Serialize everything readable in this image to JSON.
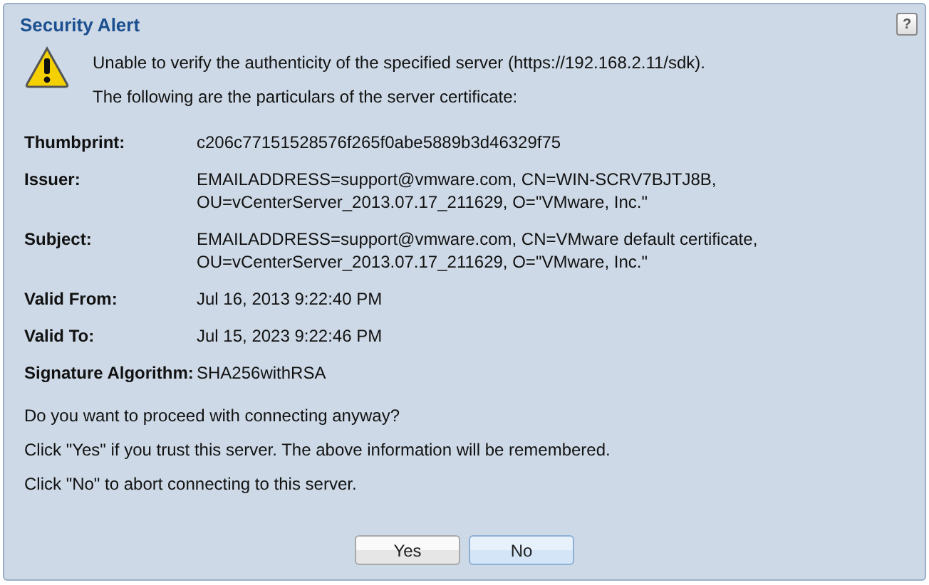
{
  "dialog": {
    "title": "Security Alert",
    "help": "?",
    "messages": [
      "Unable to verify the authenticity of the specified server (https://192.168.2.11/sdk).",
      "The following are the particulars of the server certificate:"
    ],
    "fields": [
      {
        "label": "Thumbprint:",
        "value": [
          "c206c77151528576f265f0abe5889b3d46329f75"
        ]
      },
      {
        "label": "Issuer:",
        "value": [
          "EMAILADDRESS=support@vmware.com, CN=WIN-SCRV7BJTJ8B,",
          "OU=vCenterServer_2013.07.17_211629, O=\"VMware, Inc.\""
        ]
      },
      {
        "label": "Subject:",
        "value": [
          "EMAILADDRESS=support@vmware.com, CN=VMware default certificate,",
          "OU=vCenterServer_2013.07.17_211629, O=\"VMware, Inc.\""
        ]
      },
      {
        "label": "Valid From:",
        "value": [
          "Jul 16, 2013 9:22:40 PM"
        ]
      },
      {
        "label": "Valid To:",
        "value": [
          "Jul 15, 2023 9:22:46 PM"
        ]
      },
      {
        "label": "Signature Algorithm:",
        "value": [
          "SHA256withRSA"
        ]
      }
    ],
    "questions": [
      "Do you want to proceed with connecting anyway?",
      "Click \"Yes\" if you trust this server. The above information will be remembered.",
      "Click \"No\" to abort connecting to this server."
    ],
    "buttons": [
      {
        "label": "Yes",
        "selected": false
      },
      {
        "label": "No",
        "selected": true
      }
    ]
  }
}
